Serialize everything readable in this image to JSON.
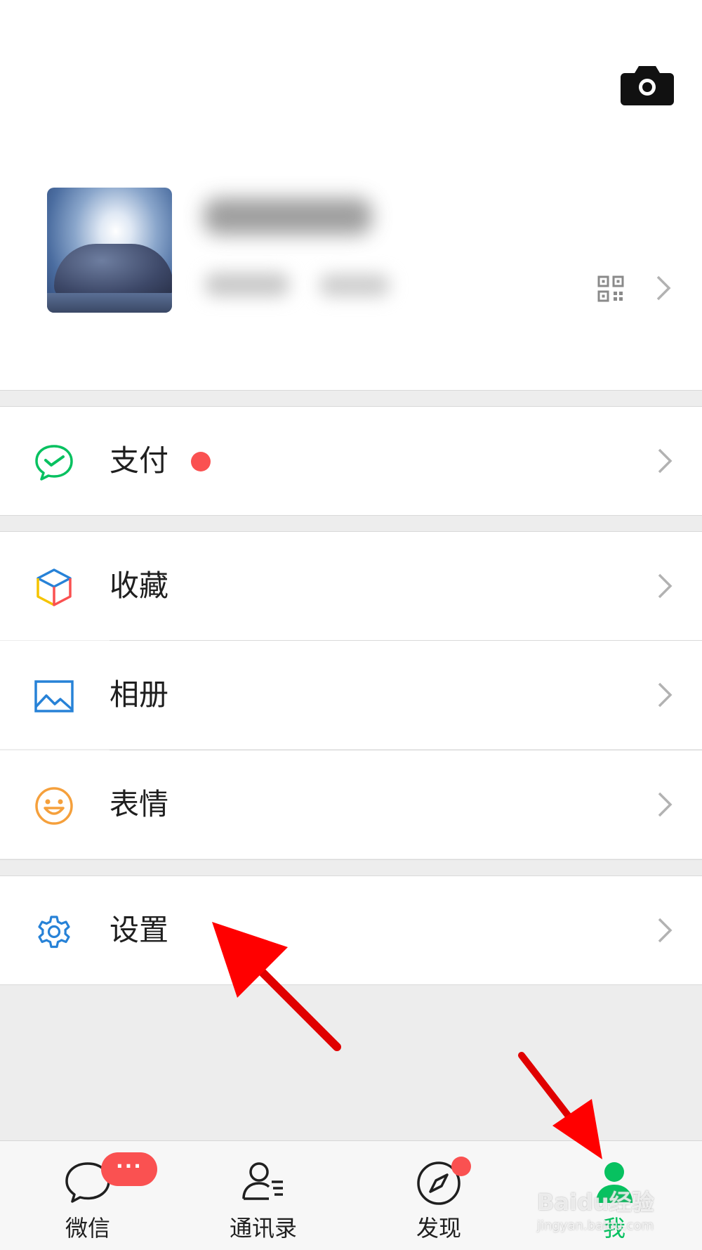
{
  "profile": {
    "camera_icon": "camera-icon",
    "qr_icon": "qr-code-icon",
    "chevron_icon": "chevron-right-icon"
  },
  "menu": [
    {
      "label": "支付",
      "icon": "wechat-pay-icon",
      "icon_color": "#07c160",
      "has_dot": true
    },
    {
      "label": "收藏",
      "icon": "favorites-cube-icon",
      "icon_color": "#f5a623"
    },
    {
      "label": "相册",
      "icon": "album-picture-icon",
      "icon_color": "#2782d7"
    },
    {
      "label": "表情",
      "icon": "sticker-smile-icon",
      "icon_color": "#f5a03c"
    },
    {
      "label": "设置",
      "icon": "settings-gear-icon",
      "icon_color": "#2782d7"
    }
  ],
  "tabbar": {
    "tabs": [
      {
        "label": "微信",
        "icon": "chat-bubble-icon",
        "badge": "···"
      },
      {
        "label": "通讯录",
        "icon": "contacts-icon"
      },
      {
        "label": "发现",
        "icon": "compass-icon",
        "has_dot": true
      },
      {
        "label": "我",
        "icon": "me-person-icon",
        "active": true
      }
    ],
    "active_color": "#07c160"
  },
  "colors": {
    "accent": "#07c160",
    "badge": "#fa5151",
    "annotation_arrow": "#ff0000"
  },
  "watermark": {
    "main": "Baidu经验",
    "sub": "jingyan.baidu.com"
  }
}
